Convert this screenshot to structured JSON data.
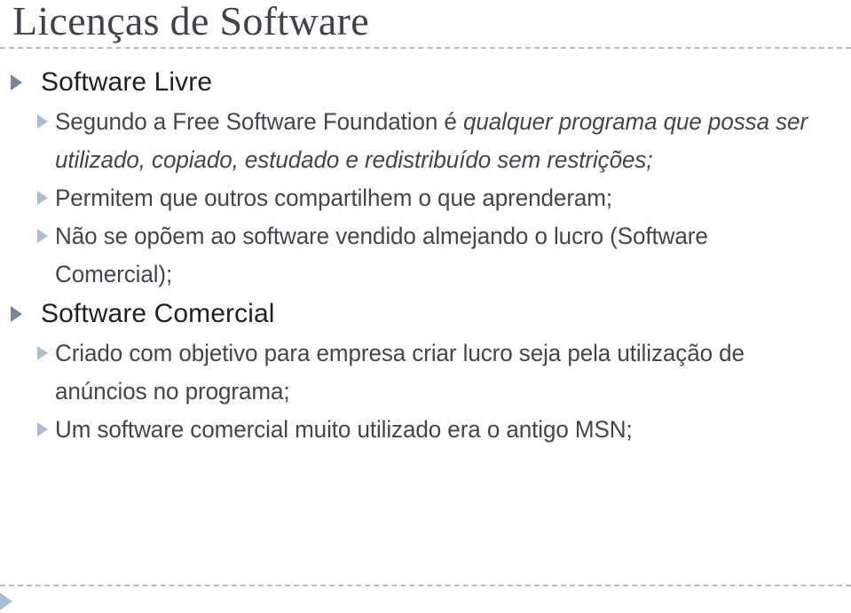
{
  "slide": {
    "title": "Licenças de Software",
    "sections": [
      {
        "heading": "Software Livre",
        "bullet_icon": "triangle-right-icon",
        "items": [
          {
            "lines": [
              {
                "text": "Segundo a Free Software Foundation é ",
                "style": "normal"
              },
              {
                "text": "qualquer programa que possa ser utilizado, copiado, estudado e redistribuído sem restrições;",
                "style": "italic"
              }
            ]
          },
          {
            "lines": [
              {
                "text": "Permitem que outros compartilhem o que aprenderam;",
                "style": "normal"
              }
            ]
          },
          {
            "lines": [
              {
                "text": "Não se opõem  ao software vendido almejando o lucro (Software Comercial);",
                "style": "normal"
              }
            ]
          }
        ]
      },
      {
        "heading": "Software Comercial",
        "bullet_icon": "triangle-right-icon",
        "items": [
          {
            "lines": [
              {
                "text": "Criado com objetivo para empresa criar lucro seja pela utilização de anúncios no programa;",
                "style": "normal"
              }
            ]
          },
          {
            "lines": [
              {
                "text": "Um software comercial muito utilizado era o antigo MSN;",
                "style": "normal"
              }
            ]
          }
        ]
      }
    ],
    "footer": {
      "bullet_icon": "triangle-right-icon"
    },
    "colors": {
      "title": "#3f434f",
      "heading": "#231f20",
      "body": "#45454c",
      "bullet_level1": "#7a839f",
      "bullet_level2": "#a9bdd4",
      "rule": "#b9bcc4",
      "background": "#ffffff"
    }
  }
}
